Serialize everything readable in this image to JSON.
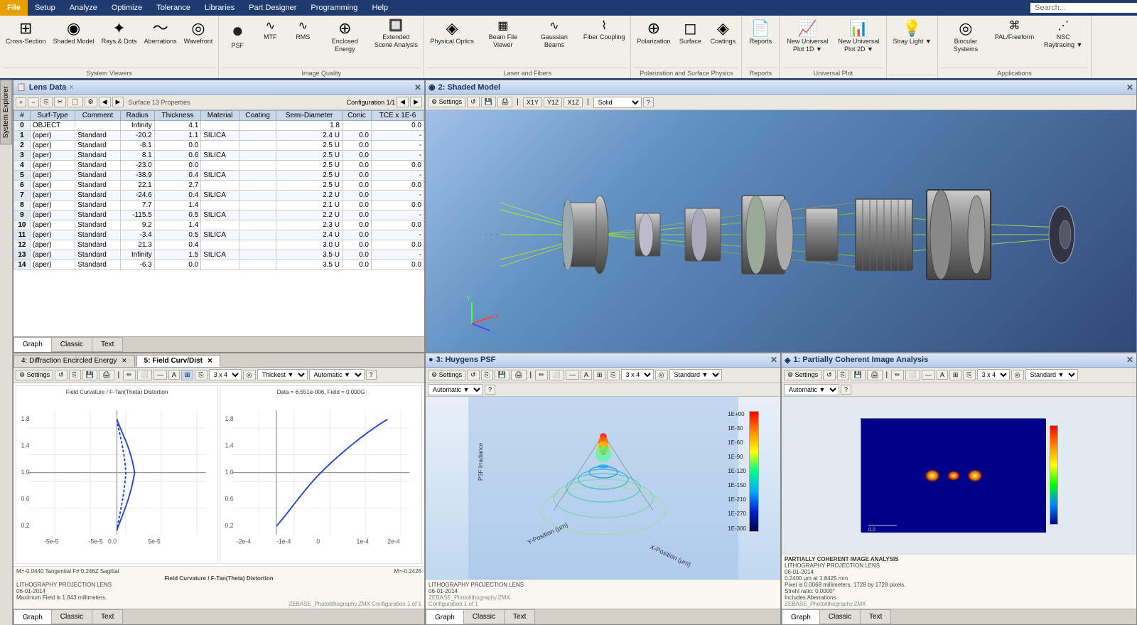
{
  "menubar": {
    "file": "File",
    "setup": "Setup",
    "analyze": "Analyze",
    "optimize": "Optimize",
    "tolerance": "Tolerance",
    "libraries": "Libraries",
    "part_designer": "Part Designer",
    "programming": "Programming",
    "help": "Help",
    "search_placeholder": "Search..."
  },
  "ribbon": {
    "system_viewers": {
      "label": "System Viewers",
      "items": [
        {
          "id": "cross-section",
          "icon": "⊞",
          "label": "Cross-Section"
        },
        {
          "id": "shaded-model",
          "icon": "◉",
          "label": "Shaded Model"
        },
        {
          "id": "rays-dots",
          "icon": "✦",
          "label": "Rays &\nDots"
        },
        {
          "id": "aberrations",
          "icon": "〜",
          "label": "Aberrations"
        },
        {
          "id": "wavefront",
          "icon": "◎",
          "label": "Wavefront"
        }
      ]
    },
    "image_quality": {
      "label": "Image Quality",
      "items": [
        {
          "id": "psf",
          "icon": "●",
          "label": "PSF"
        },
        {
          "id": "mtf",
          "icon": "∿",
          "label": "MTF"
        },
        {
          "id": "rms",
          "icon": "∿",
          "label": "RMS"
        },
        {
          "id": "enclosed-energy",
          "icon": "⊕",
          "label": "Enclosed\nEnergy"
        },
        {
          "id": "extended-scene",
          "icon": "🔲",
          "label": "Extended Scene\nAnalysis"
        }
      ]
    },
    "laser_fibers": {
      "label": "Laser and Fibers",
      "items": [
        {
          "id": "physical-optics",
          "icon": "◈",
          "label": "Physical\nOptics"
        },
        {
          "id": "beam-file",
          "icon": "▦",
          "label": "Beam File\nViewer"
        },
        {
          "id": "gaussian-beams",
          "icon": "∿",
          "label": "Gaussian\nBeams"
        },
        {
          "id": "fiber-coupling",
          "icon": "⌇",
          "label": "Fiber\nCoupling"
        }
      ]
    },
    "pol_surface": {
      "label": "Polarization and Surface Physics",
      "items": [
        {
          "id": "polarization",
          "icon": "⊕",
          "label": "Polarization"
        },
        {
          "id": "surface",
          "icon": "◻",
          "label": "Surface"
        },
        {
          "id": "coatings",
          "icon": "◈",
          "label": "Coatings"
        }
      ]
    },
    "reports": {
      "label": "Reports",
      "items": [
        {
          "id": "reports",
          "icon": "📄",
          "label": "Reports"
        }
      ]
    },
    "universal_plot": {
      "label": "Universal Plot",
      "items": [
        {
          "id": "new-universal-1d",
          "icon": "📈",
          "label": "New Universal\nPlot 1D"
        },
        {
          "id": "new-universal-2d",
          "icon": "📊",
          "label": "New Universal\nPlot 2D"
        }
      ]
    },
    "stray_light": {
      "label": "",
      "items": [
        {
          "id": "stray-light",
          "icon": "💡",
          "label": "Stray\nLight"
        }
      ]
    },
    "applications": {
      "label": "Applications",
      "items": [
        {
          "id": "biocular",
          "icon": "◎",
          "label": "Biocular\nSystems"
        },
        {
          "id": "pal-freeform",
          "icon": "⌘",
          "label": "PAL/Freeform"
        },
        {
          "id": "nsc-raytracing",
          "icon": "⋰",
          "label": "NSC\nRaytracing"
        }
      ]
    }
  },
  "sidebar": {
    "system_explorer": "System Explorer"
  },
  "lens_panel": {
    "title": "Lens Data",
    "subtitle": "Surface 13 Properties",
    "config": "Configuration 1/1",
    "columns": [
      "#",
      "Surf-Type",
      "Comment",
      "Radius",
      "Thickness",
      "Material",
      "Coating",
      "Semi-Diameter",
      "Conic",
      "TCE x 1E-6"
    ],
    "rows": [
      {
        "n": "0",
        "type": "OBJECT",
        "comment": "",
        "radius": "Infinity",
        "thick": "4.1",
        "mat": "",
        "coat": "",
        "sd": "1.8",
        "conic": "",
        "tce": "0.0"
      },
      {
        "n": "1",
        "type": "(aper)",
        "comment": "Standard",
        "radius": "-20.2",
        "thick": "1.1",
        "mat": "SILICA",
        "coat": "",
        "sd": "2.4 U",
        "conic": "0.0",
        "tce": "-"
      },
      {
        "n": "2",
        "type": "(aper)",
        "comment": "Standard",
        "radius": "-8.1",
        "thick": "0.0",
        "mat": "",
        "coat": "",
        "sd": "2.5 U",
        "conic": "0.0",
        "tce": "-"
      },
      {
        "n": "3",
        "type": "(aper)",
        "comment": "Standard",
        "radius": "8.1",
        "thick": "0.6",
        "mat": "SILICA",
        "coat": "",
        "sd": "2.5 U",
        "conic": "0.0",
        "tce": "-"
      },
      {
        "n": "4",
        "type": "(aper)",
        "comment": "Standard",
        "radius": "-23.0",
        "thick": "0.0",
        "mat": "",
        "coat": "",
        "sd": "2.5 U",
        "conic": "0.0",
        "tce": "0.0"
      },
      {
        "n": "5",
        "type": "(aper)",
        "comment": "Standard",
        "radius": "-38.9",
        "thick": "0.4",
        "mat": "SILICA",
        "coat": "",
        "sd": "2.5 U",
        "conic": "0.0",
        "tce": "-"
      },
      {
        "n": "6",
        "type": "(aper)",
        "comment": "Standard",
        "radius": "22.1",
        "thick": "2.7",
        "mat": "",
        "coat": "",
        "sd": "2.5 U",
        "conic": "0.0",
        "tce": "0.0"
      },
      {
        "n": "7",
        "type": "(aper)",
        "comment": "Standard",
        "radius": "-24.6",
        "thick": "0.4",
        "mat": "SILICA",
        "coat": "",
        "sd": "2.2 U",
        "conic": "0.0",
        "tce": "-"
      },
      {
        "n": "8",
        "type": "(aper)",
        "comment": "Standard",
        "radius": "7.7",
        "thick": "1.4",
        "mat": "",
        "coat": "",
        "sd": "2.1 U",
        "conic": "0.0",
        "tce": "0.0"
      },
      {
        "n": "9",
        "type": "(aper)",
        "comment": "Standard",
        "radius": "-115.5",
        "thick": "0.5",
        "mat": "SILICA",
        "coat": "",
        "sd": "2.2 U",
        "conic": "0.0",
        "tce": "-"
      },
      {
        "n": "10",
        "type": "(aper)",
        "comment": "Standard",
        "radius": "9.2",
        "thick": "1.4",
        "mat": "",
        "coat": "",
        "sd": "2.3 U",
        "conic": "0.0",
        "tce": "0.0"
      },
      {
        "n": "11",
        "type": "(aper)",
        "comment": "Standard",
        "radius": "-3.4",
        "thick": "0.5",
        "mat": "SILICA",
        "coat": "",
        "sd": "2.4 U",
        "conic": "0.0",
        "tce": "-"
      },
      {
        "n": "12",
        "type": "(aper)",
        "comment": "Standard",
        "radius": "21.3",
        "thick": "0.4",
        "mat": "",
        "coat": "",
        "sd": "3.0 U",
        "conic": "0.0",
        "tce": "0.0"
      },
      {
        "n": "13",
        "type": "(aper)",
        "comment": "Standard",
        "radius": "Infinity",
        "thick": "1.5",
        "mat": "SILICA",
        "coat": "",
        "sd": "3.5 U",
        "conic": "0.0",
        "tce": "-"
      },
      {
        "n": "14",
        "type": "(aper)",
        "comment": "Standard",
        "radius": "-6.3",
        "thick": "0.0",
        "mat": "",
        "coat": "",
        "sd": "3.5 U",
        "conic": "0.0",
        "tce": "0.0"
      }
    ],
    "bottom_tabs": [
      "Graph",
      "Classic",
      "Text"
    ]
  },
  "shaded_panel": {
    "title": "2: Shaded Model",
    "toolbar_solid": "Solid ▼"
  },
  "field_panel": {
    "tabs": [
      {
        "id": "diff-encircled",
        "label": "4: Diffraction Encircled Energy",
        "active": false
      },
      {
        "id": "field-curv",
        "label": "5: Field Curv/Dist",
        "active": true
      }
    ],
    "chart1_title": "Field Curvature / F-Tan(Theta) Distortion",
    "chart2_title": "Data = 6.551e-006, Field = 0.000G",
    "thickest": "Thickest ▼",
    "automatic": "Automatic ▼",
    "grid": "3 x 4 ▼",
    "bottom_tabs": [
      "Graph",
      "Classic",
      "Text"
    ],
    "footer1": "M=-0.0440 Tangential F# 0.246Z Sagittal",
    "footer2": "M=-0.2426",
    "main_label": "Field Curvature / F-Tan(Theta) Distortion",
    "sub_label1": "LITHOGRAPHY PROJECTION LENS",
    "sub_label2": "06-01-2014",
    "sub_label3": "Maximum Field is 1.843 millimeters.",
    "watermark": "ZEBASE_Photolithography.ZMX\nConfiguration 1 of 1"
  },
  "huygens_panel": {
    "title": "3: Huygens PSF",
    "standard": "Standard ▼",
    "automatic": "Automatic ▼",
    "grid": "3 x 4 ▼",
    "bottom_tabs": [
      "Graph",
      "Classic",
      "Text"
    ],
    "sub_label1": "LITHOGRAPHY PROJECTION LENS",
    "sub_label2": "06-01-2014",
    "colorbar_labels": [
      "1E+00",
      "1E-30",
      "1E-60",
      "1E-90",
      "1E-120",
      "1E-150",
      "1E-210",
      "1E-270",
      "1E-300"
    ]
  },
  "pci_panel": {
    "title": "1: Partially Coherent Image Analysis",
    "standard": "Standard ▼",
    "automatic": "Automatic ▼",
    "grid": "3 x 4 ▼",
    "bottom_tabs": [
      "Graph",
      "Classic",
      "Text"
    ],
    "sub_label1": "LITHOGRAPHY PROJECTION LENS",
    "sub_label2": "06-01-2014",
    "info1": "0.2400 µm at 1.8425 mm",
    "info2": "Pixel is 0.0068 millimeters, 1728 by 1728 pixels.",
    "info3": "Strehl ratio: 0.0000°",
    "info4": "Includes Aberrations",
    "watermark": "ZEBASE_Photolithography.ZMX",
    "section_header": "PARTIALLY COHERENT IMAGE ANALYSIS"
  }
}
